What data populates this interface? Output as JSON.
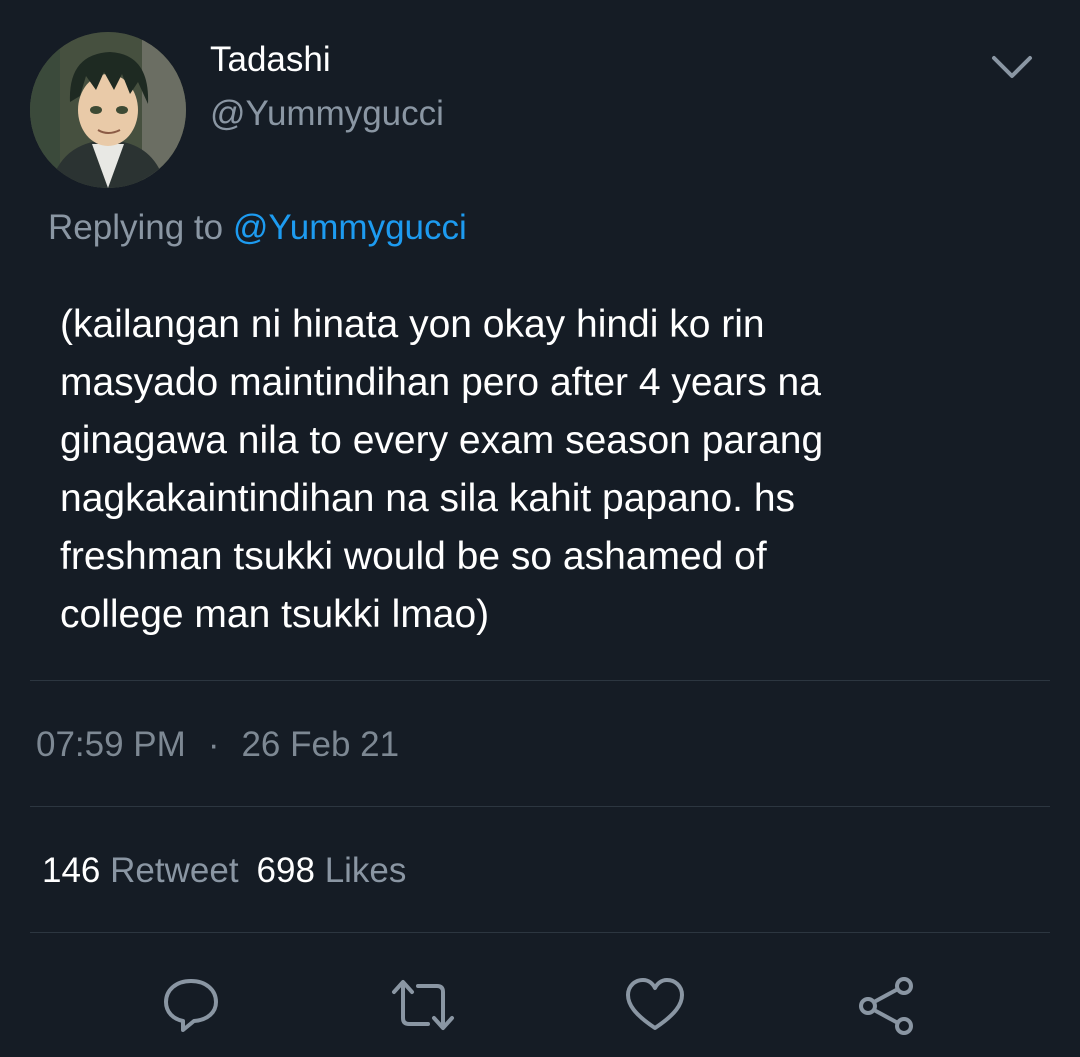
{
  "author": {
    "name": "Tadashi",
    "handle": "@Yummygucci"
  },
  "reply": {
    "prefix": "Replying to",
    "mention": "@Yummygucci"
  },
  "tweet": {
    "text_lines": [
      "(kailangan ni hinata yon okay hindi ko rin",
      "masyado maintindihan pero after 4 years na",
      "ginagawa nila to every exam season parang",
      "nagkakaintindihan na sila kahit papano. hs",
      "freshman tsukki would be so ashamed of",
      "college man tsukki lmao)"
    ],
    "time": "07:59 PM",
    "separator": "·",
    "date": "26 Feb 21"
  },
  "stats": {
    "retweets_count": "146",
    "retweets_label": "Retweet",
    "likes_count": "698",
    "likes_label": "Likes"
  },
  "icons": {
    "menu": "chevron-down-icon",
    "reply": "comment-icon",
    "retweet": "retweet-icon",
    "like": "heart-icon",
    "share": "share-icon"
  },
  "colors": {
    "background": "#151c25",
    "primary_text": "#ffffff",
    "secondary_text": "#8a96a3",
    "mention": "#1d9bf0",
    "divider": "#2c3640",
    "icon": "#8a96a3"
  }
}
